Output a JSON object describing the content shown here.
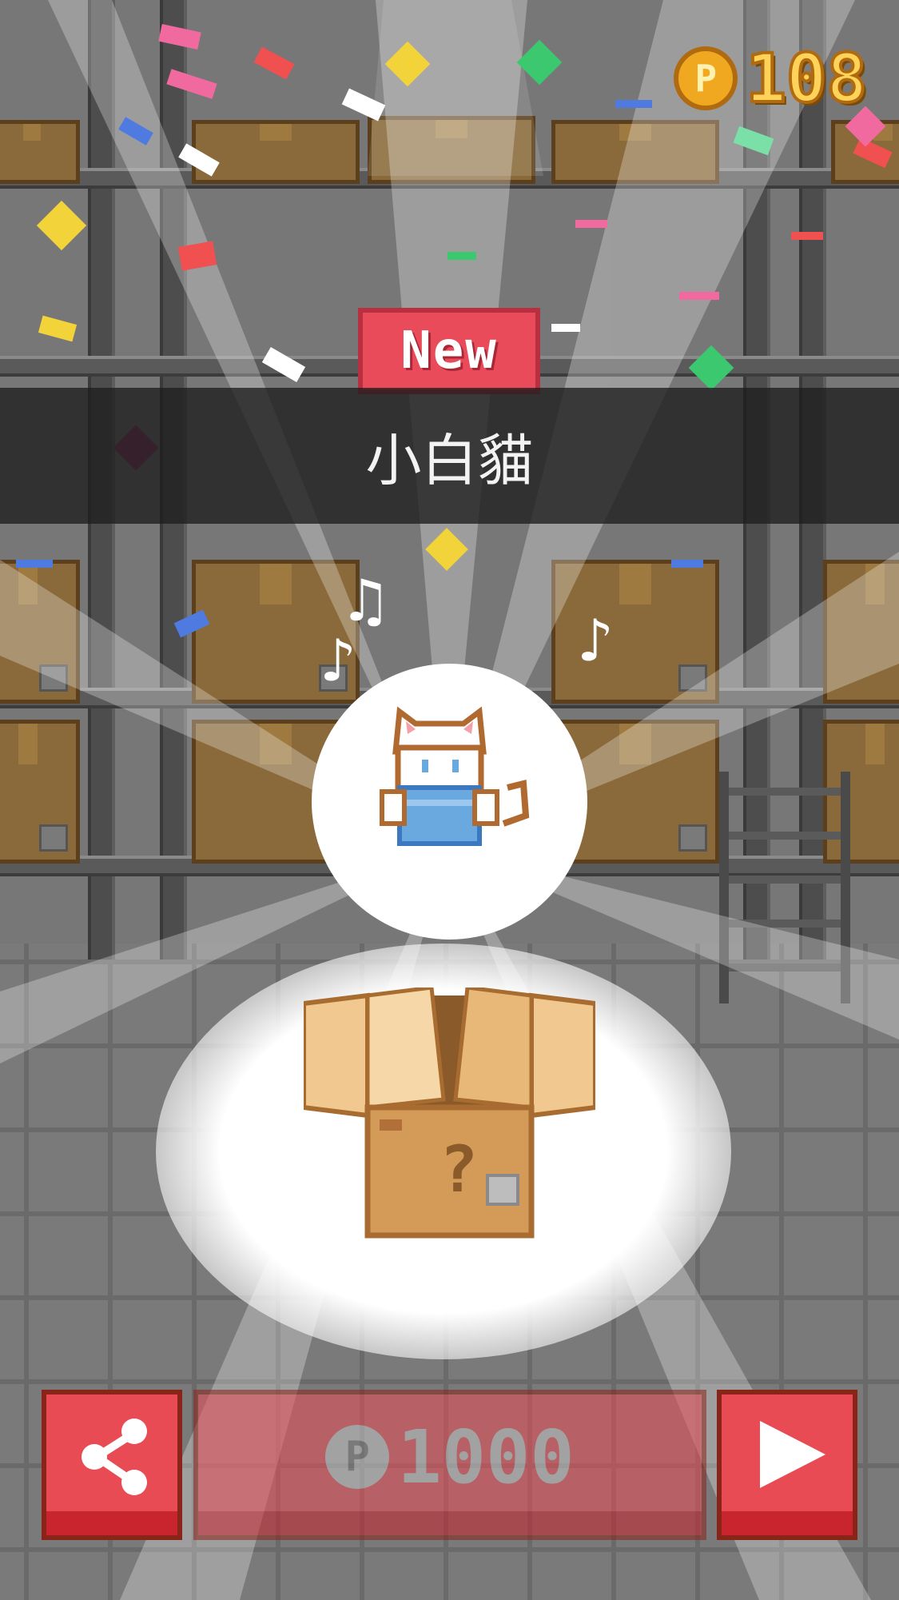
{
  "hud": {
    "coin_symbol": "P",
    "coin_count": "108"
  },
  "reveal": {
    "badge": "New",
    "cat_name": "小白貓",
    "music_notes": [
      "♫",
      "♪",
      "♪"
    ]
  },
  "actions": {
    "buy_symbol": "P",
    "buy_price": "1000"
  },
  "colors": {
    "button_red": "#e94b55",
    "coin_gold": "#f0a820",
    "badge_red": "#e94b5a"
  },
  "icons": [
    "coin-icon",
    "share-icon",
    "play-icon"
  ]
}
